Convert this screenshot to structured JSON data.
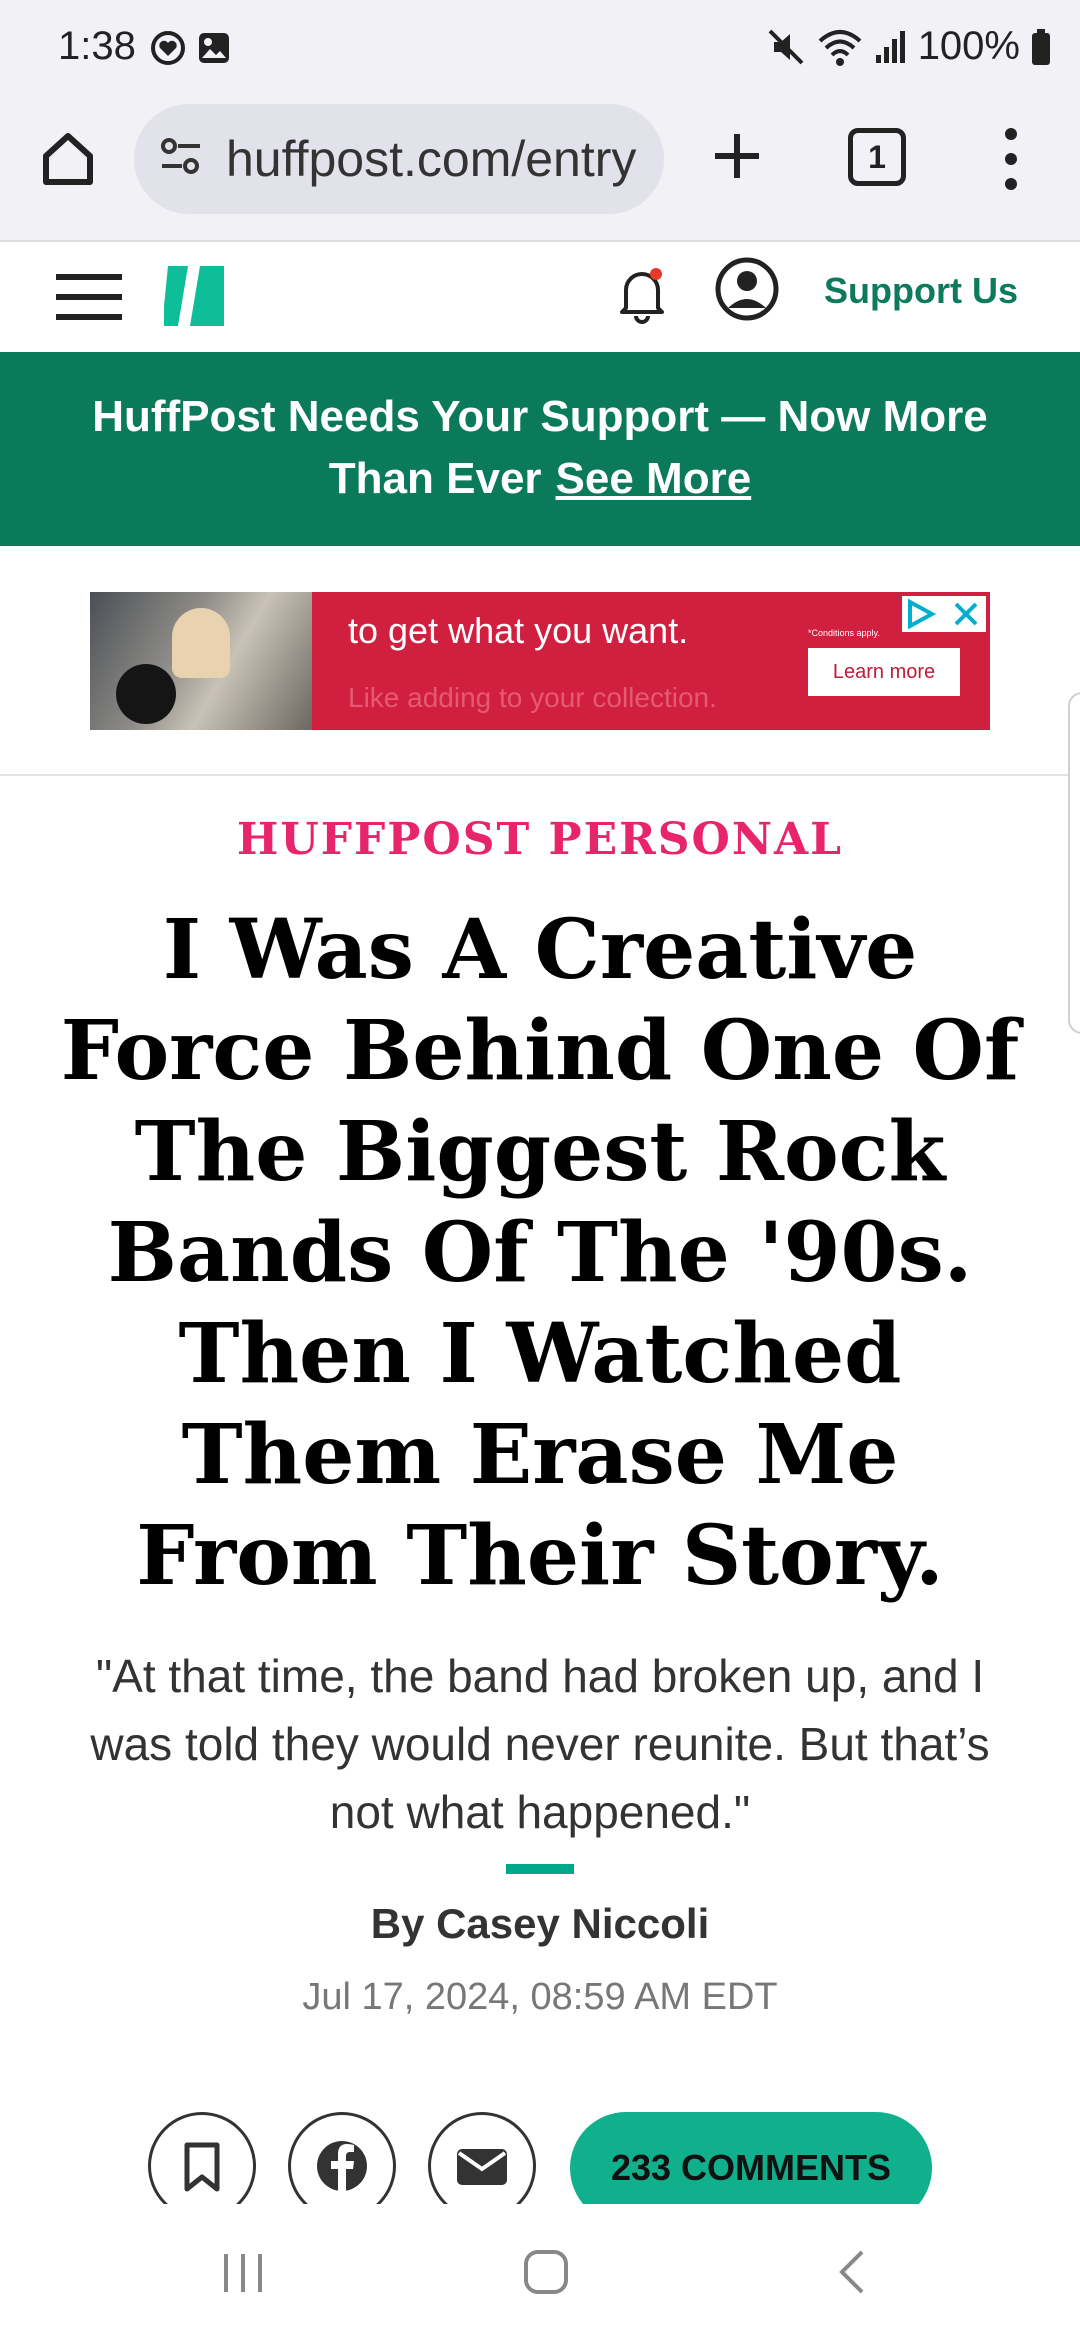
{
  "status_bar": {
    "time": "1:38",
    "battery": "100%",
    "icons": [
      "heart-shield-icon",
      "image-icon",
      "mute-icon",
      "wifi-icon",
      "signal-icon",
      "battery-icon"
    ]
  },
  "browser": {
    "url": "huffpost.com/entry",
    "tab_count": "1",
    "icons": [
      "home-icon",
      "site-settings-icon",
      "plus-icon",
      "tabs-icon",
      "more-vert-icon"
    ]
  },
  "site_header": {
    "support_label": "Support Us",
    "accent": "#0d7a5c"
  },
  "banner": {
    "text": "HuffPost Needs Your Support — Now More Than Ever",
    "link": "See More",
    "background": "#0b7a5a"
  },
  "ad": {
    "headline": "to get what you want.",
    "subtext": "Like adding to your collection.",
    "conditions": "*Conditions apply.",
    "cta": "Learn more",
    "background": "#d11f3f"
  },
  "article": {
    "kicker": "HUFFPOST PERSONAL",
    "kicker_color": "#e8246b",
    "headline": "I Was A Creative Force Behind One Of The Biggest Rock Bands Of The '90s. Then I Watched Them Erase Me From Their Story.",
    "dek": "\"At that time, the band had broken up, and I was told they would never reunite. But that’s not what happened.\"",
    "byline": "By Casey Niccoli",
    "date": "Jul 17, 2024, 08:59 AM EDT"
  },
  "share": {
    "comments_label": "233 COMMENTS",
    "comments_color": "#0fb08b"
  }
}
